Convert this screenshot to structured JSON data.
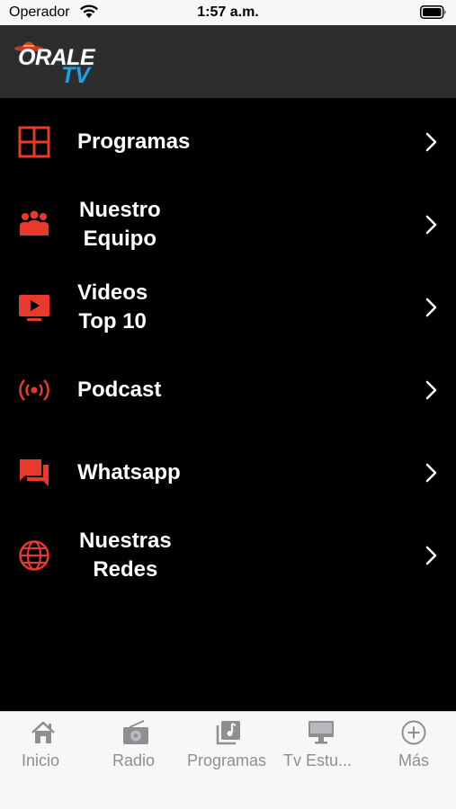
{
  "status_bar": {
    "carrier": "Operador",
    "time": "1:57 a.m."
  },
  "header": {
    "logo_word": "ORALE",
    "logo_tv": "TV"
  },
  "menu": {
    "items": [
      {
        "label": "Programas",
        "icon": "grid-icon"
      },
      {
        "label": "Nuestro\nEquipo",
        "icon": "team-icon"
      },
      {
        "label": "Videos\nTop 10",
        "icon": "video-play-icon"
      },
      {
        "label": "Podcast",
        "icon": "broadcast-icon"
      },
      {
        "label": "Whatsapp",
        "icon": "chat-icon"
      },
      {
        "label": "Nuestras\nRedes",
        "icon": "globe-icon"
      }
    ]
  },
  "tabbar": {
    "tabs": [
      {
        "label": "Inicio",
        "icon": "home-icon"
      },
      {
        "label": "Radio",
        "icon": "radio-icon"
      },
      {
        "label": "Programas",
        "icon": "music-note-icon"
      },
      {
        "label": "Tv  Estu...",
        "icon": "monitor-icon"
      },
      {
        "label": "Más",
        "icon": "plus-circle-icon"
      }
    ]
  },
  "colors": {
    "accent": "#e8392c",
    "background": "#000000",
    "header_bg": "#2d2d2d",
    "tab_inactive": "#8e8e93",
    "logo_tv": "#1aa3e8"
  }
}
